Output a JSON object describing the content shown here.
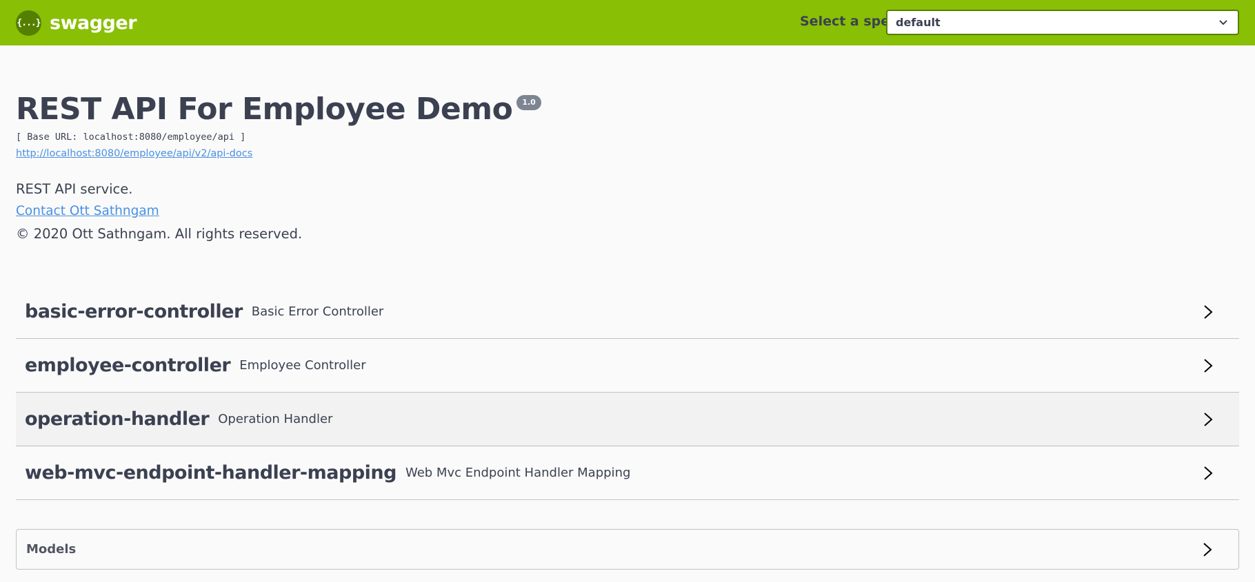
{
  "topbar": {
    "logo_glyph": "{...}",
    "brand_name": "swagger",
    "spec_label": "Select a spec",
    "spec_selected": "default",
    "colors": {
      "background": "#89bf04",
      "logo": "#547f00"
    }
  },
  "info": {
    "title": "REST API For Employee Demo",
    "version": "1.0",
    "base_url": "[ Base URL: localhost:8080/employee/api ]",
    "docs_link": "http://localhost:8080/employee/api/v2/api-docs",
    "description": "REST API service.",
    "contact_link": "Contact Ott Sathngam",
    "copyright": "© 2020 Ott Sathngam. All rights reserved."
  },
  "tags": [
    {
      "name": "basic-error-controller",
      "description": "Basic Error Controller",
      "icon": "chevron-right-icon"
    },
    {
      "name": "employee-controller",
      "description": "Employee Controller",
      "icon": "chevron-right-icon"
    },
    {
      "name": "operation-handler",
      "description": "Operation Handler",
      "icon": "chevron-right-icon",
      "highlighted": true
    },
    {
      "name": "web-mvc-endpoint-handler-mapping",
      "description": "Web Mvc Endpoint Handler Mapping",
      "icon": "chevron-right-icon"
    }
  ],
  "models": {
    "label": "Models",
    "icon": "chevron-right-icon"
  }
}
